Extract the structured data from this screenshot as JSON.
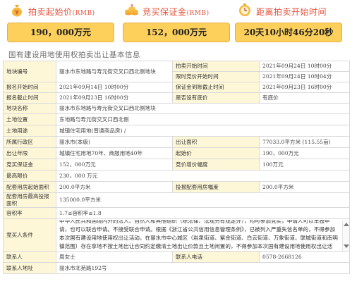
{
  "summary": {
    "start_price": {
      "title": "拍卖起始价",
      "unit": "(RMB)",
      "value": "190，000万元",
      "icon": "money-bag-icon"
    },
    "deposit": {
      "title": "竞买保证金",
      "unit": "(RMB)",
      "value": "152，000万元",
      "icon": "coins-icon"
    },
    "countdown": {
      "title": "距离拍卖开始时间",
      "value": "20天10小时46分20秒",
      "icon": "clock-icon"
    }
  },
  "section_title": "国有建设用地使用权拍卖出让基本信息",
  "table": {
    "parcel_no_label": "地块编号",
    "parcel_no_value": "丽水市东地路与寿元街交叉口西北侧地块",
    "auction_start_label": "拍卖开始时间",
    "auction_start_value": "2021年09月24日 10时00分",
    "bid_deadline_label": "限时竞价开始时间",
    "bid_deadline_value": "2021年09月24日 10时04分",
    "reg_start_label": "报名开始时间",
    "reg_start_value": "2021年09月14日 10时00分",
    "deposit_deadline_label": "保证金到账截止时间",
    "deposit_deadline_value": "2021年09月23日 16时00分",
    "reg_end_label": "报名截止时间",
    "reg_end_value": "2021年09月23日 16时00分",
    "reserve_label": "是否设有底价",
    "reserve_value": "有底价",
    "parcel_name_label": "地块名称",
    "parcel_name_value": "丽水市东地路与寿元街交叉口西北侧地块",
    "location_label": "土地位置",
    "location_value": "东地路与寿元街交叉口西北侧",
    "usage_label": "土地用途",
    "usage_value": "城镇住宅用地(普通商品房) /",
    "district_label": "所属行政区",
    "district_value": "丽水市(本级)",
    "area_label": "出让面积",
    "area_value": "77033.0平方米 (115.55亩)",
    "term_label": "出让年限",
    "term_value": "城镇住宅用地70年、商服用地40年",
    "start_price_label": "起始价",
    "start_price_value": "190，000万元",
    "deposit_label": "竞买保证金",
    "deposit_value": "152，000万元",
    "increment_label": "竞价增价幅度",
    "increment_value": "100万元",
    "max_price_label": "最高限价",
    "max_price_value": "230，000 万元",
    "housing_start_label": "配套用房起始面积",
    "housing_start_value": "200.0平方米",
    "housing_inc_label": "投报配套用房幅度",
    "housing_inc_value": "200.0平方米",
    "housing_max_label": "配套用房最高投报面积",
    "housing_max_value": "135000.0平方米",
    "far_label": "容积率",
    "far_value": "1.7≤容积率≤1.8",
    "conditions_label": "竞买人条件",
    "conditions_value": "中华人民共和国境内外的法人、自然人和其他组织（除法律、法规另有规定外），均可参加竞买，申请人可以单独申请，也可以联合申请。不接受联合申请。根据《浙江省公共信用信息管理条例》，已被列入严重失信名单的，不得参加本次国有建设用地使用权出让活动。在丽水市中心城区（岩泉街道、紫金街道、白云街道、万象街道、联城街道和南明镇范围）存在拿地不按土地出让合同约定缴清土地出让价款且土地闲置的，不得参加本次国有建设用地使用权出让活动。",
    "contact_label": "联系人",
    "contact_value": "周女士",
    "phone_label": "联系人电话",
    "phone_value": "0578-2668126",
    "address_label": "联系人地址",
    "address_value": "丽水市北苑路192号"
  }
}
